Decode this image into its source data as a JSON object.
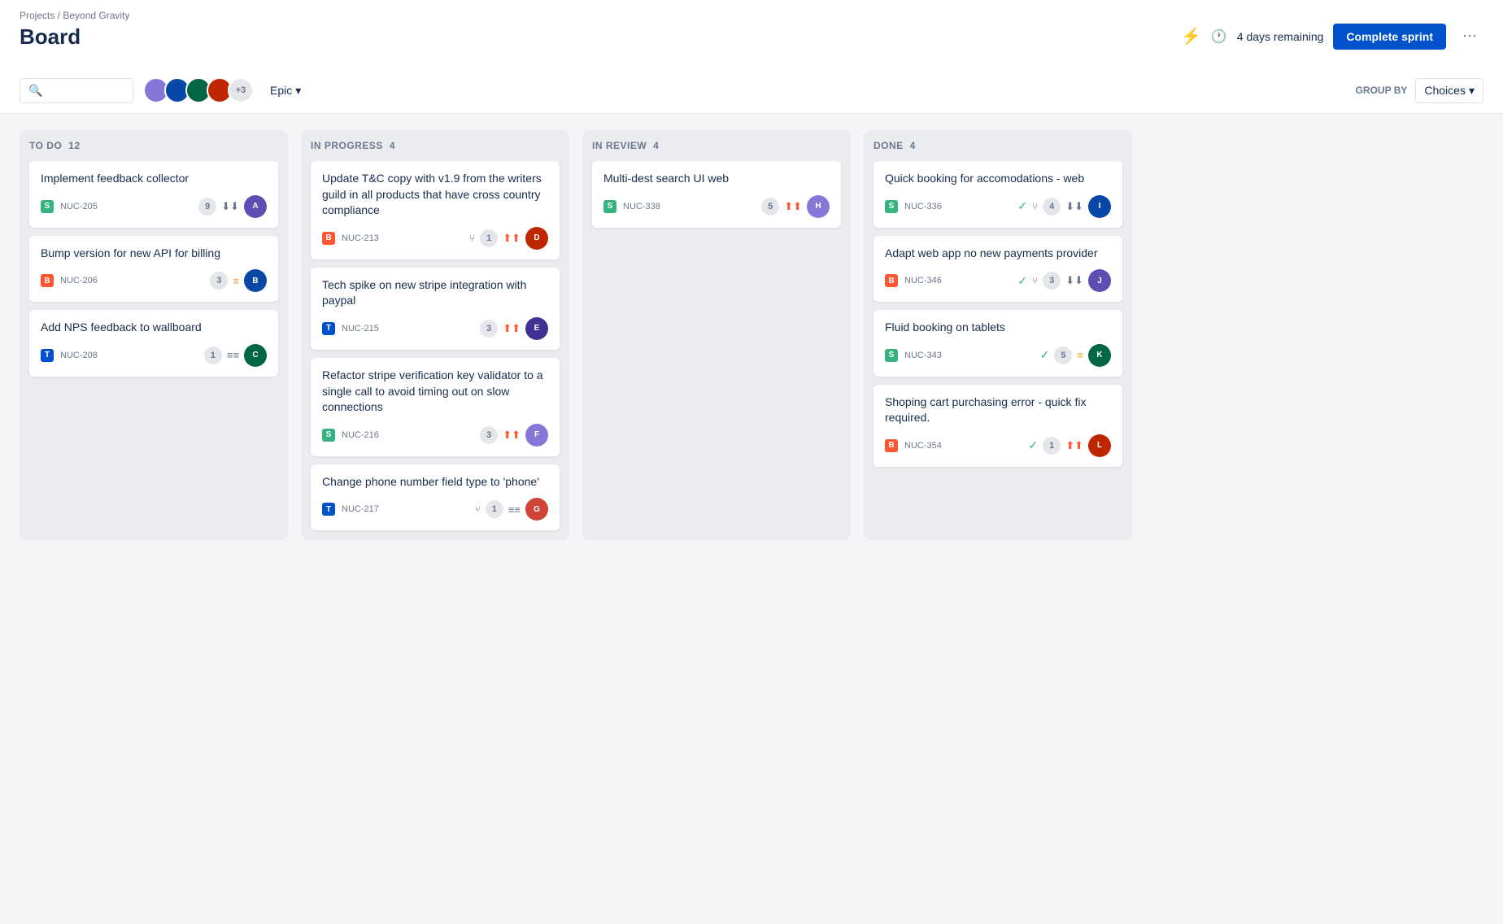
{
  "breadcrumb": "Projects / Beyond Gravity",
  "page_title": "Board",
  "days_remaining": "4 days remaining",
  "complete_sprint_label": "Complete sprint",
  "group_by_label": "GROUP BY",
  "choices_label": "Choices",
  "epic_label": "Epic",
  "search_placeholder": "",
  "avatar_count": "+3",
  "more_icon": "⋯",
  "columns": [
    {
      "id": "todo",
      "title": "TO DO",
      "count": 12,
      "cards": [
        {
          "title": "Implement feedback collector",
          "issue_type": "story",
          "issue_id": "NUC-205",
          "badge": "9",
          "priority": "low",
          "avatar_initials": "A",
          "avatar_class": "av-1"
        },
        {
          "title": "Bump version for new API for billing",
          "issue_type": "bug",
          "issue_id": "NUC-206",
          "badge": "3",
          "priority": "medium",
          "avatar_initials": "B",
          "avatar_class": "av-2"
        },
        {
          "title": "Add NPS feedback to wallboard",
          "issue_type": "task",
          "issue_id": "NUC-208",
          "badge": "1",
          "priority": "low2",
          "avatar_initials": "C",
          "avatar_class": "av-3"
        }
      ]
    },
    {
      "id": "inprogress",
      "title": "IN PROGRESS",
      "count": 4,
      "cards": [
        {
          "title": "Update T&C copy with v1.9 from the writers guild in all products that have cross country compliance",
          "issue_type": "bug",
          "issue_id": "NUC-213",
          "badge": "1",
          "priority": "high",
          "avatar_initials": "D",
          "avatar_class": "av-4",
          "has_branch": true
        },
        {
          "title": "Tech spike on new stripe integration with paypal",
          "issue_type": "task",
          "issue_id": "NUC-215",
          "badge": "3",
          "priority": "high",
          "avatar_initials": "E",
          "avatar_class": "av-5"
        },
        {
          "title": "Refactor stripe verification key validator to a single call to avoid timing out on slow connections",
          "issue_type": "story",
          "issue_id": "NUC-216",
          "badge": "3",
          "priority": "high",
          "avatar_initials": "F",
          "avatar_class": "av-6"
        },
        {
          "title": "Change phone number field type to 'phone'",
          "issue_type": "task",
          "issue_id": "NUC-217",
          "badge": "1",
          "priority": "low2",
          "avatar_initials": "G",
          "avatar_class": "av-7",
          "has_branch": true
        }
      ]
    },
    {
      "id": "inreview",
      "title": "IN REVIEW",
      "count": 4,
      "cards": [
        {
          "title": "Multi-dest search UI web",
          "issue_type": "story",
          "issue_id": "NUC-338",
          "badge": "5",
          "priority": "high",
          "avatar_initials": "H",
          "avatar_class": "av-6"
        }
      ]
    },
    {
      "id": "done",
      "title": "DONE",
      "count": 4,
      "cards": [
        {
          "title": "Quick booking for accomodations - web",
          "issue_type": "story",
          "issue_id": "NUC-336",
          "badge": "4",
          "priority": "low",
          "avatar_initials": "I",
          "avatar_class": "av-2",
          "has_check": true,
          "has_branch": true
        },
        {
          "title": "Adapt web app no new payments provider",
          "issue_type": "bug",
          "issue_id": "NUC-346",
          "badge": "3",
          "priority": "low",
          "avatar_initials": "J",
          "avatar_class": "av-1",
          "has_check": true,
          "has_branch": true
        },
        {
          "title": "Fluid booking on tablets",
          "issue_type": "story",
          "issue_id": "NUC-343",
          "badge": "5",
          "priority": "medium",
          "avatar_initials": "K",
          "avatar_class": "av-3",
          "has_check": true
        },
        {
          "title": "Shoping cart purchasing error - quick fix required.",
          "issue_type": "bug",
          "issue_id": "NUC-354",
          "badge": "1",
          "priority": "high",
          "avatar_initials": "L",
          "avatar_class": "av-4",
          "has_check": true
        }
      ]
    }
  ]
}
